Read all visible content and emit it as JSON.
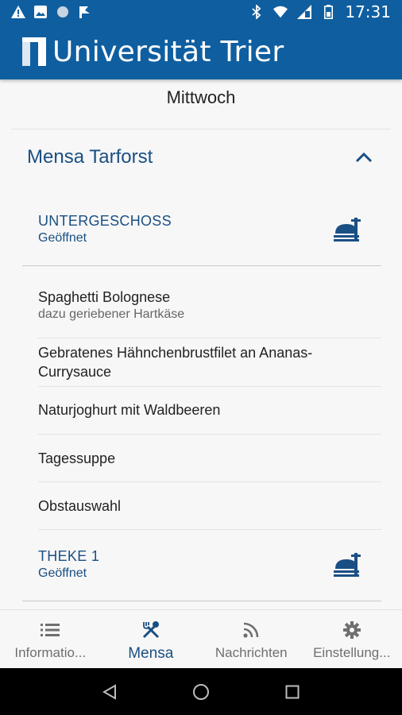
{
  "status_bar": {
    "time": "17:31",
    "left_icons": [
      "warning-icon",
      "image-icon",
      "circle-icon",
      "flag-icon"
    ],
    "right_icons": [
      "bluetooth-icon",
      "wifi-icon",
      "signal-icon",
      "battery-icon"
    ]
  },
  "header": {
    "brand": "Universität Trier"
  },
  "day": "Mittwoch",
  "mensa": {
    "name": "Mensa Tarforst",
    "sections": [
      {
        "title": "UNTERGESCHOSS",
        "status": "Geöffnet",
        "meals": [
          {
            "name": "Spaghetti Bolognese",
            "sub": "dazu geriebener Hartkäse"
          },
          {
            "name": "Gebratenes Hähnchenbrustfilet an Ananas-Currysauce",
            "sub": ""
          },
          {
            "name": "Naturjoghurt mit Waldbeeren",
            "sub": ""
          },
          {
            "name": "Tagessuppe",
            "sub": ""
          },
          {
            "name": "Obstauswahl",
            "sub": ""
          }
        ]
      },
      {
        "title": "THEKE 1",
        "status": "Geöffnet",
        "meals": []
      }
    ]
  },
  "bottom_nav": {
    "items": [
      {
        "label": "Informatio...",
        "icon": "list-icon"
      },
      {
        "label": "Mensa",
        "icon": "cutlery-icon",
        "active": true
      },
      {
        "label": "Nachrichten",
        "icon": "rss-icon"
      },
      {
        "label": "Einstellung...",
        "icon": "gear-icon"
      }
    ]
  },
  "colors": {
    "primary": "#0f5fa0",
    "accent": "#1a4f84"
  }
}
